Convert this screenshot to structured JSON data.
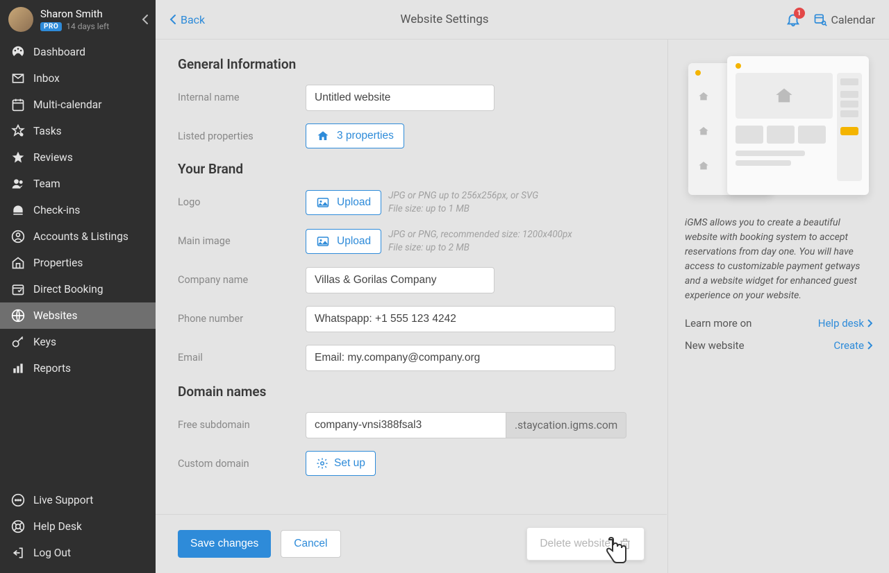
{
  "user": {
    "name": "Sharon Smith",
    "badge": "PRO",
    "days_left": "14 days left"
  },
  "sidebar": {
    "items": [
      {
        "label": "Dashboard"
      },
      {
        "label": "Inbox"
      },
      {
        "label": "Multi-calendar"
      },
      {
        "label": "Tasks"
      },
      {
        "label": "Reviews"
      },
      {
        "label": "Team"
      },
      {
        "label": "Check-ins"
      },
      {
        "label": "Accounts & Listings"
      },
      {
        "label": "Properties"
      },
      {
        "label": "Direct Booking"
      },
      {
        "label": "Websites"
      },
      {
        "label": "Keys"
      },
      {
        "label": "Reports"
      }
    ],
    "footer": [
      {
        "label": "Live Support"
      },
      {
        "label": "Help Desk"
      },
      {
        "label": "Log Out"
      }
    ]
  },
  "topbar": {
    "back": "Back",
    "title": "Website Settings",
    "calendar": "Calendar",
    "notif_count": "1"
  },
  "sections": {
    "general": {
      "title": "General Information",
      "internal_name_label": "Internal name",
      "internal_name_value": "Untitled website",
      "listed_properties_label": "Listed properties",
      "properties_btn": "3 properties"
    },
    "brand": {
      "title": "Your Brand",
      "logo_label": "Logo",
      "logo_upload": "Upload",
      "logo_hint1": "JPG or PNG up to 256x256px, or SVG",
      "logo_hint2": "File size: up to 1 MB",
      "main_image_label": "Main image",
      "main_image_upload": "Upload",
      "main_image_hint1": "JPG or PNG, recommended size: 1200x400px",
      "main_image_hint2": "File size: up to 2 MB",
      "company_label": "Company name",
      "company_value": "Villas & Gorilas Company",
      "phone_label": "Phone number",
      "phone_value": "Whatspapp: +1 555 123 4242",
      "email_label": "Email",
      "email_value": "Email: my.company@company.org"
    },
    "domain": {
      "title": "Domain names",
      "free_sub_label": "Free subdomain",
      "free_sub_value": "company-vnsi388fsal3",
      "free_sub_suffix": ".staycation.igms.com",
      "custom_label": "Custom domain",
      "setup_btn": "Set up"
    }
  },
  "footer": {
    "save": "Save changes",
    "cancel": "Cancel",
    "delete": "Delete website"
  },
  "info": {
    "text": "iGMS allows you to create a beautiful website with booking system to accept reservations from day one. You will have access to customizable payment getways and a website widget for enhanced guest experience on your website.",
    "learn_label": "Learn more on",
    "learn_link": "Help desk",
    "new_label": "New website",
    "new_link": "Create"
  }
}
